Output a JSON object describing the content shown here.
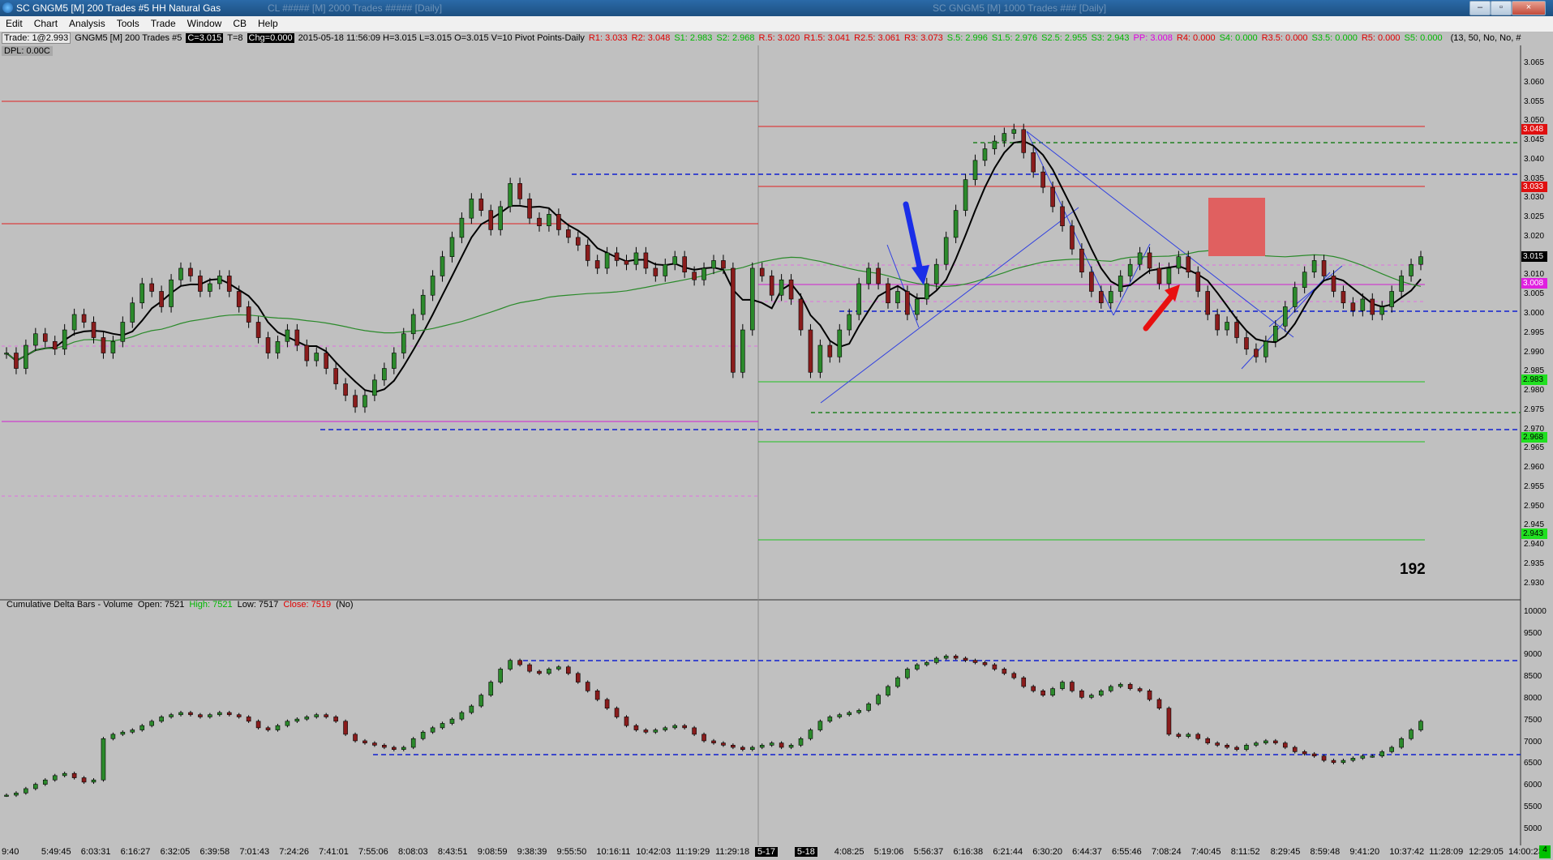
{
  "window": {
    "title": "SC GNGM5 [M]  200 Trades  #5  HH Natural Gas",
    "background_titles": [
      "CL ##### [M] 2000 Trades ##### [Daily]",
      "SC GNGM5 [M] 1000 Trades ### [Daily]"
    ],
    "minimize": "–",
    "maximize": "▫",
    "close": "×"
  },
  "menu": [
    "Edit",
    "Chart",
    "Analysis",
    "Tools",
    "Trade",
    "Window",
    "CB",
    "Help"
  ],
  "infobar": {
    "trade": "Trade: 1@2.993",
    "symbol": "GNGM5 [M]  200 Trades  #5",
    "close": "C=3.015",
    "t": "T=8",
    "chg": "Chg=0.000",
    "ohlc": "2015-05-18 11:56:09 H=3.015 L=3.015 O=3.015 V=10 Pivot Points-Daily",
    "pivots": [
      {
        "text": "R1: 3.033",
        "color": "red"
      },
      {
        "text": "R2: 3.048",
        "color": "red"
      },
      {
        "text": "S1: 2.983",
        "color": "grn"
      },
      {
        "text": "S2: 2.968",
        "color": "grn"
      },
      {
        "text": "R.5: 3.020",
        "color": "red"
      },
      {
        "text": "R1.5: 3.041",
        "color": "red"
      },
      {
        "text": "R2.5: 3.061",
        "color": "red"
      },
      {
        "text": "R3: 3.073",
        "color": "red"
      },
      {
        "text": "S.5: 2.996",
        "color": "grn"
      },
      {
        "text": "S1.5: 2.976",
        "color": "grn"
      },
      {
        "text": "S2.5: 2.955",
        "color": "grn"
      },
      {
        "text": "S3: 2.943",
        "color": "grn"
      },
      {
        "text": "PP: 3.008",
        "color": "mag"
      },
      {
        "text": "R4: 0.000",
        "color": "red"
      },
      {
        "text": "S4: 0.000",
        "color": "grn"
      },
      {
        "text": "R3.5: 0.000",
        "color": "red"
      },
      {
        "text": "S3.5: 0.000",
        "color": "grn"
      },
      {
        "text": "R5: 0.000",
        "color": "red"
      },
      {
        "text": "S5: 0.000",
        "color": "grn"
      }
    ],
    "params": "(13, 50, No, No, #"
  },
  "dpl": "DPL: 0.00C",
  "big_number": "192",
  "price_axis": [
    "3.065",
    "3.060",
    "3.055",
    "3.050",
    "3.045",
    "3.040",
    "3.035",
    "3.030",
    "3.025",
    "3.020",
    "3.010",
    "3.005",
    "3.000",
    "2.995",
    "2.990",
    "2.985",
    "2.980",
    "2.975",
    "2.970",
    "2.965",
    "2.960",
    "2.955",
    "2.950",
    "2.945",
    "2.940",
    "2.935",
    "2.930"
  ],
  "price_tags": [
    {
      "text": "3.048",
      "bg": "#e01010",
      "fg": "#ffffff",
      "value": 3.048
    },
    {
      "text": "3.033",
      "bg": "#e01010",
      "fg": "#ffffff",
      "value": 3.033
    },
    {
      "text": "3.015",
      "bg": "#000000",
      "fg": "#ffffff",
      "value": 3.015
    },
    {
      "text": "3.008",
      "bg": "#e020e0",
      "fg": "#ffffff",
      "value": 3.008
    },
    {
      "text": "2.983",
      "bg": "#20e020",
      "fg": "#000000",
      "value": 2.983
    },
    {
      "text": "2.968",
      "bg": "#20e020",
      "fg": "#000000",
      "value": 2.968
    },
    {
      "text": "2.943",
      "bg": "#20e020",
      "fg": "#000000",
      "value": 2.943
    }
  ],
  "lower": {
    "title": "Cumulative Delta Bars - Volume",
    "open": "Open: 7521",
    "high": "High: 7521",
    "low": "Low: 7517",
    "close": "Close: 7519",
    "flag": "(No)",
    "axis": [
      "10000",
      "9500",
      "9000",
      "8500",
      "8000",
      "7500",
      "7000",
      "6500",
      "6000",
      "5500",
      "5000"
    ]
  },
  "time_axis": [
    {
      "text": "9:40"
    },
    {
      "text": "5:49:45"
    },
    {
      "text": "6:03:31"
    },
    {
      "text": "6:16:27"
    },
    {
      "text": "6:32:05"
    },
    {
      "text": "6:39:58"
    },
    {
      "text": "7:01:43"
    },
    {
      "text": "7:24:26"
    },
    {
      "text": "7:41:01"
    },
    {
      "text": "7:55:06"
    },
    {
      "text": "8:08:03"
    },
    {
      "text": "8:43:51"
    },
    {
      "text": "9:08:59"
    },
    {
      "text": "9:38:39"
    },
    {
      "text": "9:55:50"
    },
    {
      "text": "10:16:11"
    },
    {
      "text": "10:42:03"
    },
    {
      "text": "11:19:29"
    },
    {
      "text": "11:29:18"
    },
    {
      "text": "5-17",
      "date": true
    },
    {
      "text": "5-18",
      "date": true
    },
    {
      "text": "4:08:25"
    },
    {
      "text": "5:19:06"
    },
    {
      "text": "5:56:37"
    },
    {
      "text": "6:16:38"
    },
    {
      "text": "6:21:44"
    },
    {
      "text": "6:30:20"
    },
    {
      "text": "6:44:37"
    },
    {
      "text": "6:55:46"
    },
    {
      "text": "7:08:24"
    },
    {
      "text": "7:40:45"
    },
    {
      "text": "8:11:52"
    },
    {
      "text": "8:29:45"
    },
    {
      "text": "8:59:48"
    },
    {
      "text": "9:41:20"
    },
    {
      "text": "10:37:42"
    },
    {
      "text": "11:28:09"
    },
    {
      "text": "12:29:05"
    },
    {
      "text": "14:00:23"
    }
  ],
  "corner": "4",
  "chart_data": {
    "type": "candlestick",
    "price_panel": {
      "ylim": [
        2.927,
        3.069
      ],
      "closes": [
        2.99,
        2.986,
        2.992,
        2.995,
        2.993,
        2.991,
        2.996,
        3.0,
        2.998,
        2.994,
        2.99,
        2.993,
        2.998,
        3.003,
        3.008,
        3.006,
        3.002,
        3.009,
        3.012,
        3.01,
        3.006,
        3.008,
        3.01,
        3.006,
        3.002,
        2.998,
        2.994,
        2.99,
        2.993,
        2.996,
        2.992,
        2.988,
        2.99,
        2.986,
        2.982,
        2.979,
        2.976,
        2.979,
        2.983,
        2.986,
        2.99,
        2.995,
        3.0,
        3.005,
        3.01,
        3.015,
        3.02,
        3.025,
        3.03,
        3.027,
        3.022,
        3.028,
        3.034,
        3.03,
        3.025,
        3.023,
        3.026,
        3.022,
        3.02,
        3.018,
        3.014,
        3.012,
        3.016,
        3.014,
        3.013,
        3.016,
        3.012,
        3.01,
        3.013,
        3.015,
        3.011,
        3.009,
        3.012,
        3.014,
        3.012,
        2.985,
        2.996,
        3.012,
        3.01,
        3.005,
        3.009,
        3.004,
        2.996,
        2.985,
        2.992,
        2.989,
        2.996,
        3.0,
        3.008,
        3.012,
        3.008,
        3.003,
        3.006,
        3.0,
        3.004,
        3.008,
        3.013,
        3.02,
        3.027,
        3.035,
        3.04,
        3.043,
        3.045,
        3.047,
        3.048,
        3.042,
        3.037,
        3.033,
        3.028,
        3.023,
        3.017,
        3.011,
        3.006,
        3.003,
        3.006,
        3.01,
        3.013,
        3.016,
        3.012,
        3.008,
        3.012,
        3.015,
        3.011,
        3.006,
        3.0,
        2.996,
        2.998,
        2.994,
        2.991,
        2.989,
        2.993,
        2.997,
        3.002,
        3.007,
        3.011,
        3.014,
        3.01,
        3.006,
        3.003,
        3.001,
        3.004,
        3.0,
        3.002,
        3.006,
        3.01,
        3.013,
        3.015
      ]
    },
    "delta_panel": {
      "ylim": [
        4700,
        10200
      ],
      "values": [
        5800,
        5850,
        5950,
        6050,
        6150,
        6250,
        6300,
        6200,
        6100,
        6150,
        7100,
        7200,
        7250,
        7300,
        7400,
        7500,
        7600,
        7650,
        7700,
        7650,
        7600,
        7650,
        7700,
        7650,
        7600,
        7500,
        7350,
        7300,
        7400,
        7500,
        7550,
        7600,
        7650,
        7600,
        7500,
        7200,
        7050,
        7000,
        6950,
        6900,
        6850,
        6900,
        7100,
        7250,
        7350,
        7450,
        7550,
        7700,
        7850,
        8100,
        8400,
        8700,
        8900,
        8800,
        8650,
        8600,
        8700,
        8750,
        8600,
        8400,
        8200,
        8000,
        7800,
        7600,
        7400,
        7300,
        7250,
        7300,
        7350,
        7400,
        7350,
        7200,
        7050,
        7000,
        6950,
        6900,
        6850,
        6900,
        6950,
        7000,
        6900,
        6950,
        7100,
        7300,
        7500,
        7600,
        7650,
        7700,
        7750,
        7900,
        8100,
        8300,
        8500,
        8700,
        8800,
        8850,
        8950,
        9000,
        8950,
        8900,
        8850,
        8800,
        8700,
        8600,
        8500,
        8300,
        8200,
        8100,
        8250,
        8400,
        8200,
        8050,
        8100,
        8200,
        8300,
        8350,
        8250,
        8200,
        8000,
        7800,
        7200,
        7150,
        7200,
        7100,
        7000,
        6950,
        6900,
        6850,
        6950,
        7000,
        7050,
        7000,
        6900,
        6800,
        6750,
        6700,
        6600,
        6550,
        6600,
        6650,
        6700,
        6700,
        6800,
        6900,
        7100,
        7300,
        7500
      ]
    },
    "levels": [
      {
        "label": "R1",
        "value": 3.033
      },
      {
        "label": "R2",
        "value": 3.048
      },
      {
        "label": "PP",
        "value": 3.008
      },
      {
        "label": "S1",
        "value": 2.983
      },
      {
        "label": "S2",
        "value": 2.968
      },
      {
        "label": "S3",
        "value": 2.943
      }
    ]
  }
}
